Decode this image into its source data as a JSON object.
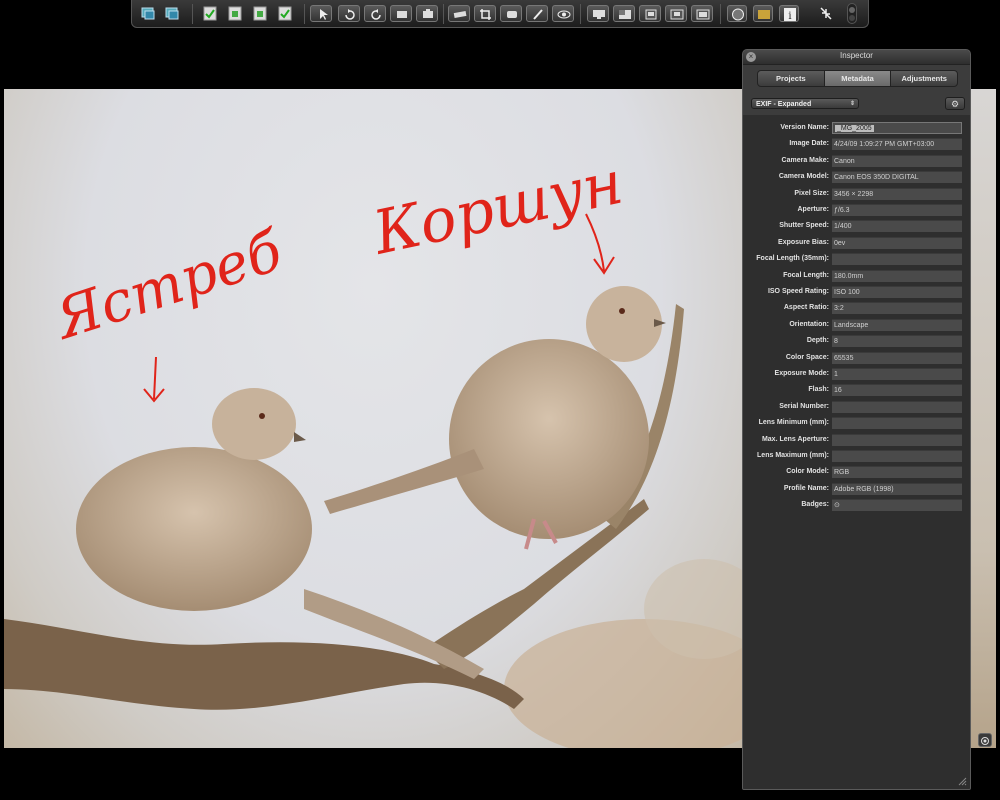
{
  "toolbar": {
    "buttons": [
      "stack-icon",
      "stack-alt-icon",
      "check-album-icon",
      "album-icon",
      "album-alt-icon",
      "check-alt-icon",
      "pointer-icon",
      "rotate-left-icon",
      "rotate-right-icon",
      "lift-icon",
      "stamp-icon",
      "straighten-icon",
      "crop-icon",
      "red-eye-icon",
      "brush-icon",
      "eye-icon",
      "monitor-icon",
      "browser-view-icon",
      "split-view-icon",
      "viewer-icon",
      "filmstrip-icon",
      "loupe-icon",
      "metadata-tag-icon",
      "info-icon",
      "fullscreen-collapse-icon",
      "toggle-icon"
    ]
  },
  "photo": {
    "annotation_left": "Ястреб",
    "annotation_right": "Коршун"
  },
  "inspector": {
    "title": "Inspector",
    "close": "×",
    "tabs": [
      "Projects",
      "Metadata",
      "Adjustments"
    ],
    "active_tab": "Metadata",
    "preset": "EXIF - Expanded",
    "preset_arrows": "⇕",
    "action_icon": "⚙",
    "fields": [
      {
        "label": "Version Name:",
        "value": "_MG_2005"
      },
      {
        "label": "Image Date:",
        "value": "4/24/09 1:09:27 PM GMT+03:00"
      },
      {
        "label": "Camera Make:",
        "value": "Canon"
      },
      {
        "label": "Camera Model:",
        "value": "Canon EOS 350D DIGITAL"
      },
      {
        "label": "Pixel Size:",
        "value": "3456 × 2298"
      },
      {
        "label": "Aperture:",
        "value": "ƒ/6.3"
      },
      {
        "label": "Shutter Speed:",
        "value": "1/400"
      },
      {
        "label": "Exposure Bias:",
        "value": "0ev"
      },
      {
        "label": "Focal Length (35mm):",
        "value": ""
      },
      {
        "label": "Focal Length:",
        "value": "180.0mm"
      },
      {
        "label": "ISO Speed Rating:",
        "value": "ISO 100"
      },
      {
        "label": "Aspect Ratio:",
        "value": "3:2"
      },
      {
        "label": "Orientation:",
        "value": "Landscape"
      },
      {
        "label": "Depth:",
        "value": "8"
      },
      {
        "label": "Color Space:",
        "value": "65535"
      },
      {
        "label": "Exposure Mode:",
        "value": "1"
      },
      {
        "label": "Flash:",
        "value": "16"
      },
      {
        "label": "Serial Number:",
        "value": ""
      },
      {
        "label": "Lens Minimum (mm):",
        "value": ""
      },
      {
        "label": "Max. Lens Aperture:",
        "value": ""
      },
      {
        "label": "Lens Maximum (mm):",
        "value": ""
      },
      {
        "label": "Color Model:",
        "value": "RGB"
      },
      {
        "label": "Profile Name:",
        "value": "Adobe RGB (1998)"
      },
      {
        "label": "Badges:",
        "value": "⊙"
      }
    ]
  }
}
